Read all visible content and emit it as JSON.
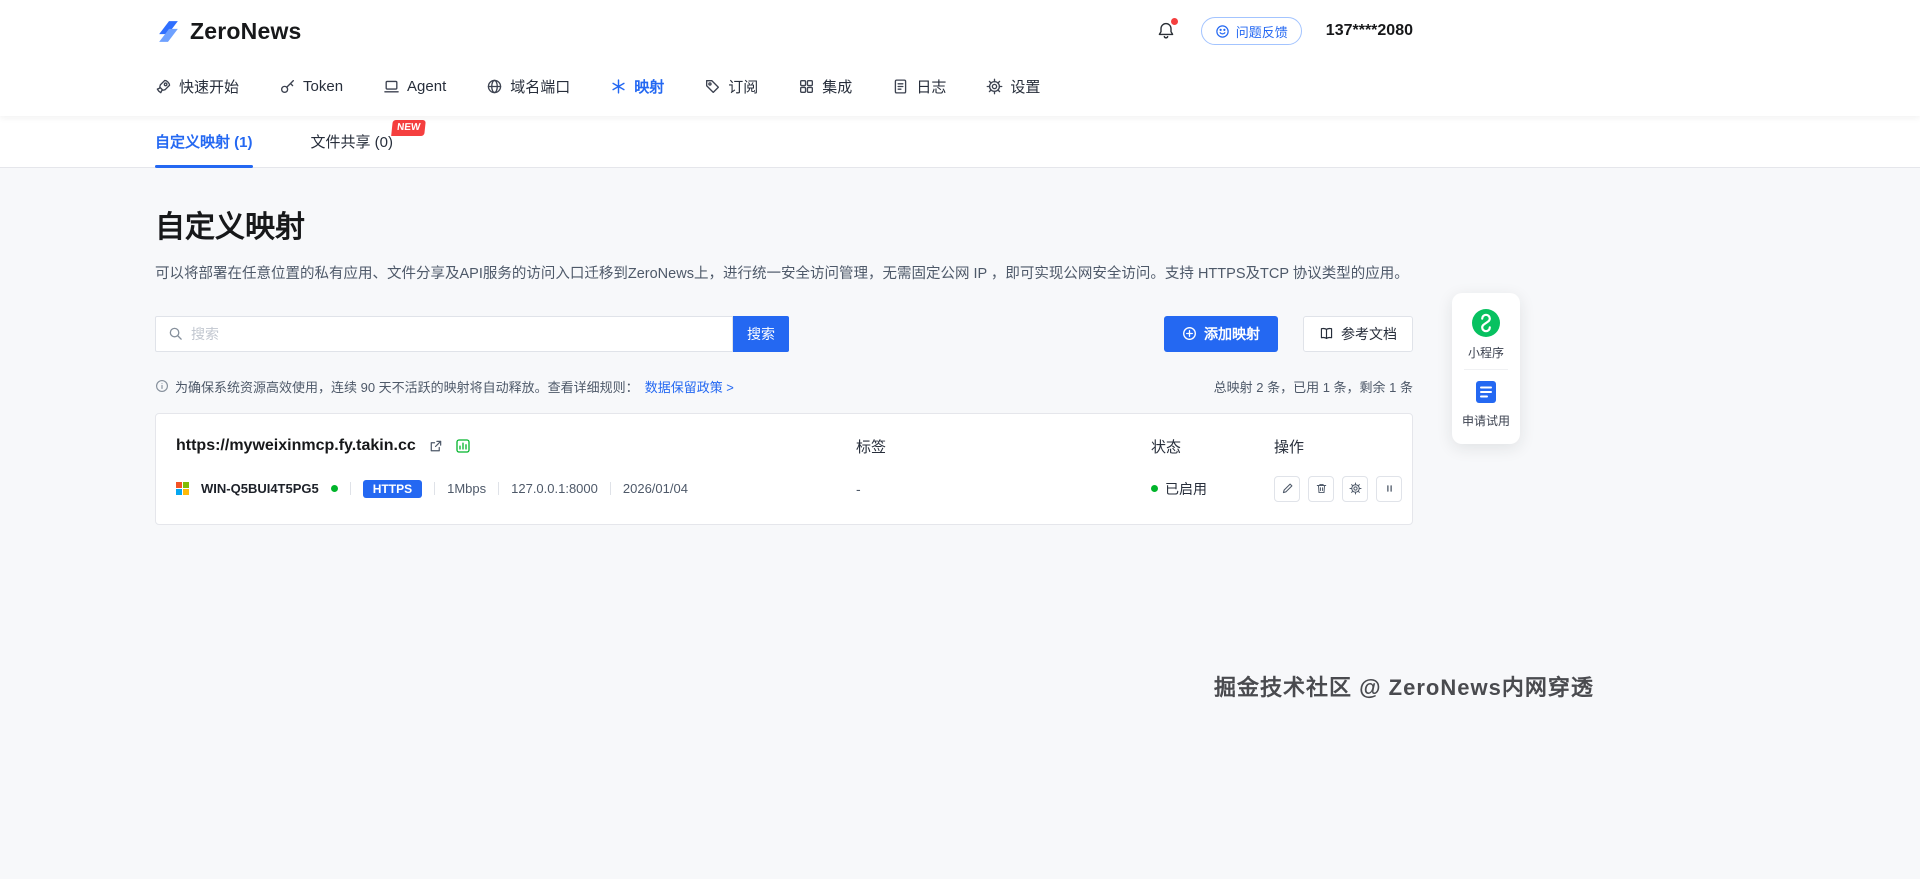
{
  "header": {
    "brand": "ZeroNews",
    "feedback_label": "问题反馈",
    "phone": "137****2080"
  },
  "nav": {
    "items": [
      {
        "label": "快速开始"
      },
      {
        "label": "Token"
      },
      {
        "label": "Agent"
      },
      {
        "label": "域名端口"
      },
      {
        "label": "映射"
      },
      {
        "label": "订阅"
      },
      {
        "label": "集成"
      },
      {
        "label": "日志"
      },
      {
        "label": "设置"
      }
    ]
  },
  "tabs": [
    {
      "label": "自定义映射 (1)"
    },
    {
      "label": "文件共享 (0)",
      "badge": "NEW"
    }
  ],
  "page": {
    "title": "自定义映射",
    "description": "可以将部署在任意位置的私有应用、文件分享及API服务的访问入口迁移到ZeroNews上，进行统一安全访问管理，无需固定公网 IP ，即可实现公网安全访问。支持 HTTPS及TCP 协议类型的应用。"
  },
  "toolbar": {
    "search_placeholder": "搜索",
    "search_button": "搜索",
    "add_button": "添加映射",
    "docs_button": "参考文档"
  },
  "notice": {
    "text": "为确保系统资源高效使用，连续 90 天不活跃的映射将自动释放。查看详细规则：",
    "link": "数据保留政策 >",
    "quota": "总映射 2 条，已用 1 条，剩余 1 条"
  },
  "mapping": {
    "columns": {
      "tag": "标签",
      "status": "状态",
      "actions": "操作"
    },
    "row": {
      "url": "https://myweixinmcp.fy.takin.cc",
      "host": "WIN-Q5BUI4T5PG5",
      "protocol": "HTTPS",
      "bandwidth": "1Mbps",
      "address": "127.0.0.1:8000",
      "expire_date": "2026/01/04",
      "tag": "-",
      "status": "已启用"
    }
  },
  "side_widget": {
    "mini_program": "小程序",
    "trial": "申请试用"
  },
  "watermark": "掘金技术社区 @ ZeroNews内网穿透",
  "colors": {
    "primary": "#2468f2",
    "success": "#00b42a",
    "danger": "#f53f3f"
  }
}
